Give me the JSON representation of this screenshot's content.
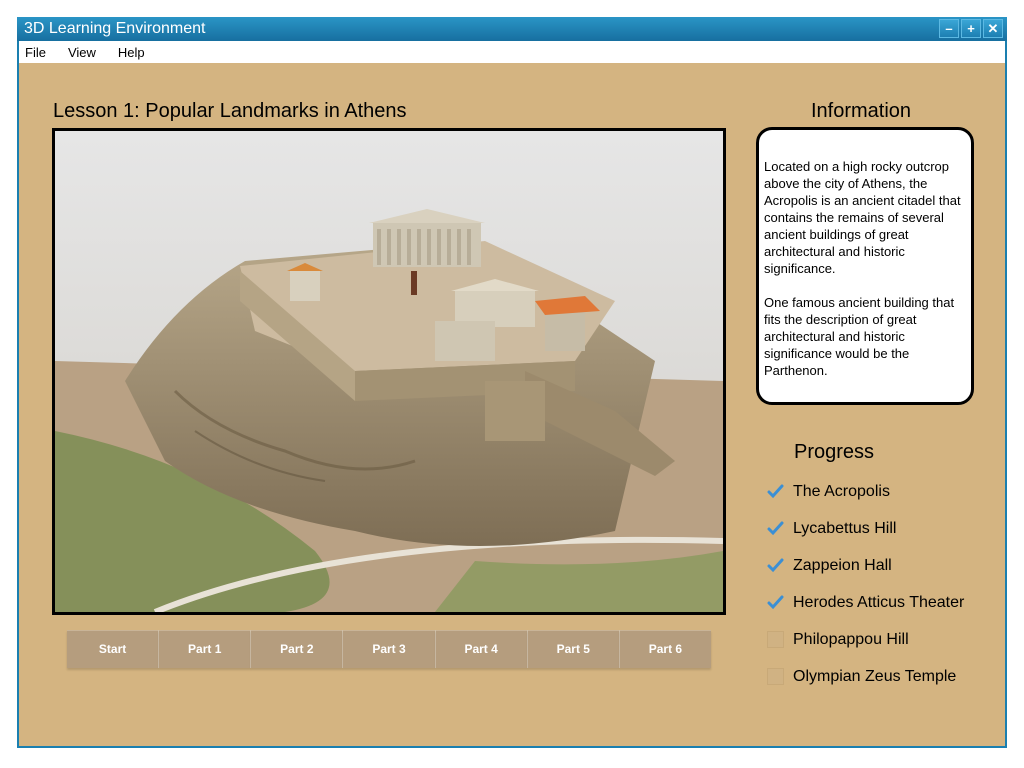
{
  "window": {
    "title": "3D Learning Environment",
    "controls": [
      "–",
      "+",
      "✕"
    ]
  },
  "menu": [
    "File",
    "View",
    "Help"
  ],
  "lesson": {
    "title": "Lesson 1: Popular Landmarks in Athens",
    "scene": "Acropolis 3D model"
  },
  "nav_buttons": [
    "Start",
    "Part 1",
    "Part 2",
    "Part 3",
    "Part 4",
    "Part 5",
    "Part 6"
  ],
  "info": {
    "heading": "Information",
    "paragraph1": "Located on a high rocky outcrop above the city of Athens, the Acropolis is an ancient citadel that contains the remains of several ancient buildings of great architectural and historic significance.",
    "paragraph2": "One famous ancient building that fits the description of great architectural and historic significance would be the Parthenon."
  },
  "progress": {
    "heading": "Progress",
    "items": [
      {
        "label": "The Acropolis",
        "checked": true
      },
      {
        "label": "Lycabettus Hill",
        "checked": true
      },
      {
        "label": "Zappeion Hall",
        "checked": true
      },
      {
        "label": "Herodes Atticus Theater",
        "checked": true
      },
      {
        "label": "Philopappou Hill",
        "checked": false
      },
      {
        "label": "Olympian Zeus Temple",
        "checked": false
      }
    ]
  },
  "colors": {
    "window_frame": "#1a7fb0",
    "content_bg": "#d4b481",
    "nav_button": "#b59d7e",
    "check_blue": "#3b8fd4"
  }
}
